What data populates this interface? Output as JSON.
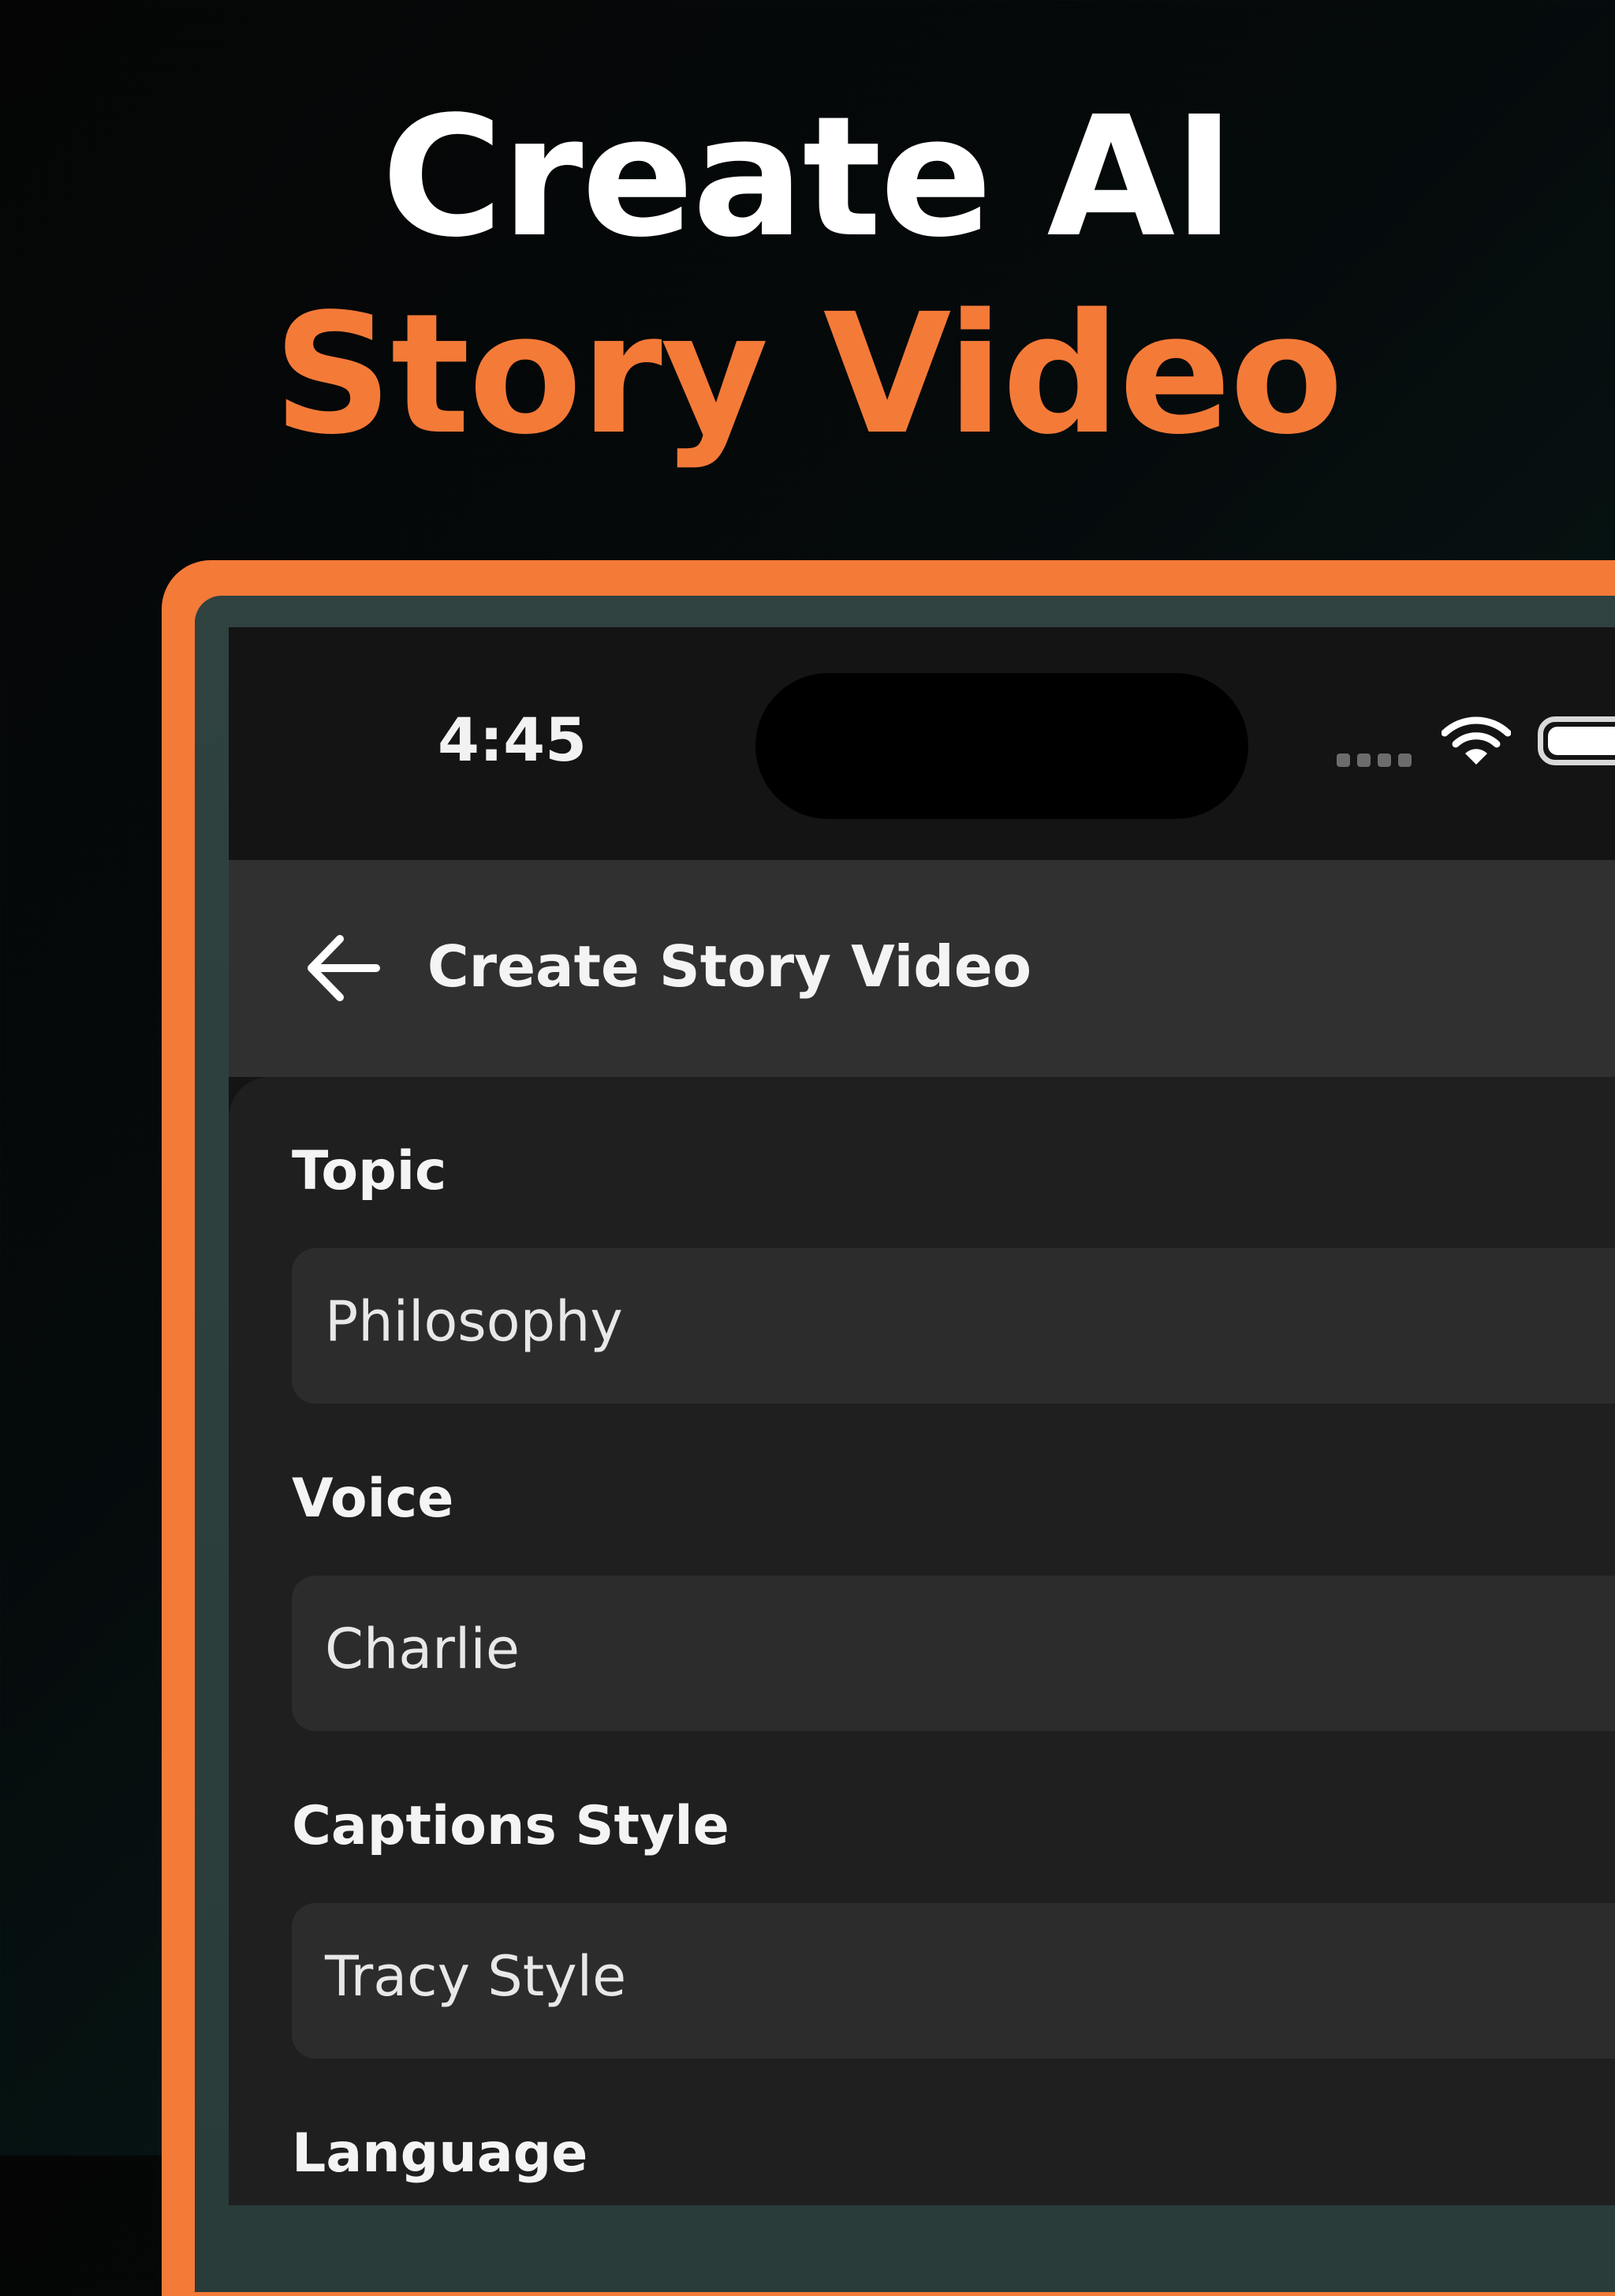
{
  "headline": {
    "line1": "Create AI",
    "line2": "Story Video"
  },
  "colors": {
    "accent": "#f47a38",
    "background": "#050a0b",
    "bezel": "#2f4240",
    "panel": "#1f1f1f",
    "field": "#2c2c2c",
    "nav": "#313031"
  },
  "status_bar": {
    "time": "4:45",
    "icons": [
      "signal-icon",
      "wifi-icon",
      "battery-icon"
    ]
  },
  "nav_bar": {
    "back_icon": "arrow-left-icon",
    "title": "Create Story Video"
  },
  "form": {
    "fields": [
      {
        "label": "Topic",
        "value": "Philosophy"
      },
      {
        "label": "Voice",
        "value": "Charlie"
      },
      {
        "label": "Captions Style",
        "value": "Tracy Style"
      },
      {
        "label": "Language"
      }
    ]
  }
}
